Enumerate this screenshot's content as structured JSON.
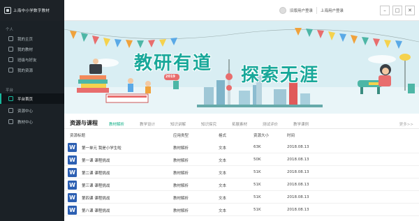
{
  "app": {
    "title": "上海中小学数字教材"
  },
  "user": {
    "links": [
      "旧版用户登录",
      "上海用户登录"
    ]
  },
  "window": {
    "minimize": "–",
    "maximize": "□",
    "close": "✕"
  },
  "sidebar": {
    "section_personal": "个人",
    "personal_items": [
      "我的主页",
      "我的教材",
      "班级与好友",
      "我的资源"
    ],
    "section_platform": "平台",
    "platform_items": [
      "平台首页",
      "资源中心",
      "教材中心"
    ]
  },
  "banner": {
    "title_1": "教研有道",
    "title_2": "探索无涯",
    "sign": "2019"
  },
  "resources": {
    "title": "资源与课程",
    "tabs": [
      "教材解析",
      "教学设计",
      "知识讲解",
      "知识探究",
      "拓展素材",
      "测试评价",
      "教学课例"
    ],
    "active_tab": 0,
    "more": "更多>>",
    "columns": [
      "资源标题",
      "应用类型",
      "格式",
      "资源大小",
      "时间"
    ],
    "rows": [
      {
        "title": "第一单元 我是小学生啦",
        "type": "教材解析",
        "format": "文本",
        "size": "63K",
        "time": "2018.08.13"
      },
      {
        "title": "第一课 课程挑战",
        "type": "教材解析",
        "format": "文本",
        "size": "50K",
        "time": "2018.08.13"
      },
      {
        "title": "第二课 课程挑战",
        "type": "教材解析",
        "format": "文本",
        "size": "51K",
        "time": "2018.08.13"
      },
      {
        "title": "第三课 课程挑战",
        "type": "教材解析",
        "format": "文本",
        "size": "51K",
        "time": "2018.08.13"
      },
      {
        "title": "第四课 课程挑战",
        "type": "教材解析",
        "format": "文本",
        "size": "51K",
        "time": "2018.08.13"
      },
      {
        "title": "第八课 课程挑战",
        "type": "教材解析",
        "format": "文本",
        "size": "51K",
        "time": "2018.08.13"
      }
    ],
    "file_icon": "word-document-icon"
  },
  "colors": {
    "accent": "#18b89c",
    "sidebar": "#1b2126",
    "banner_bg": "#d9eef3",
    "word": "#2c5fb2"
  }
}
